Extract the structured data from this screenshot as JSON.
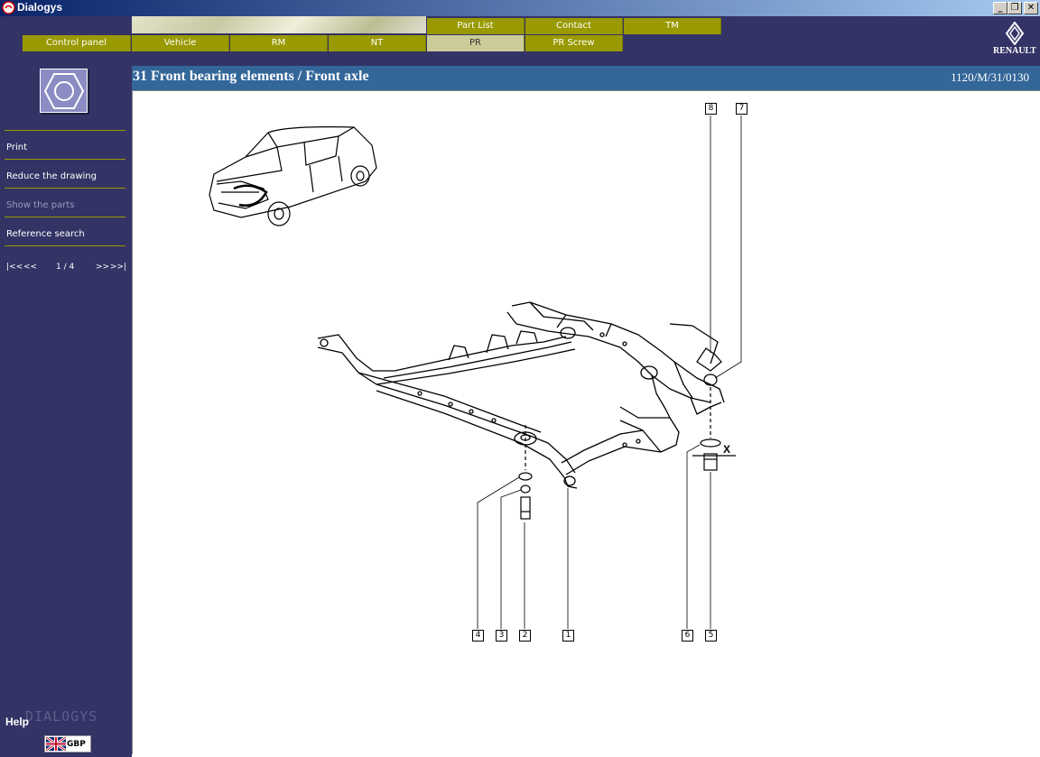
{
  "window": {
    "title": "Dialogys",
    "minimize": "_",
    "restore": "❐",
    "close": "✕"
  },
  "tabs_top": [
    {
      "label": "Part List"
    },
    {
      "label": "Contact"
    },
    {
      "label": "TM"
    }
  ],
  "tabs_bottom": [
    {
      "label": "Control panel"
    },
    {
      "label": "Vehicle"
    },
    {
      "label": "RM"
    },
    {
      "label": "NT"
    },
    {
      "label": "PR",
      "active": true
    },
    {
      "label": "PR Screw"
    }
  ],
  "brand": {
    "logo_text": "RENAULT"
  },
  "sidebar": {
    "items": [
      {
        "label": "Print"
      },
      {
        "label": "Reduce the drawing"
      },
      {
        "label": "Show the parts"
      },
      {
        "label": "Reference search"
      }
    ],
    "pager": {
      "first": "|<<",
      "prev": "<<",
      "position": "1 / 4",
      "next": ">>",
      "last": ">>|"
    },
    "watermark": "DIALOGYS",
    "help": "Help",
    "language": "GBP"
  },
  "section": {
    "title": "31 Front bearing elements / Front axle",
    "reference": "1120/M/31/0130"
  },
  "drawing": {
    "callouts": [
      "8",
      "7",
      "4",
      "3",
      "2",
      "1",
      "6",
      "5"
    ],
    "axis_label": "X"
  },
  "colors": {
    "navy": "#333366",
    "olive": "#999900",
    "olive_active": "#cccc99",
    "section_blue": "#336699"
  }
}
